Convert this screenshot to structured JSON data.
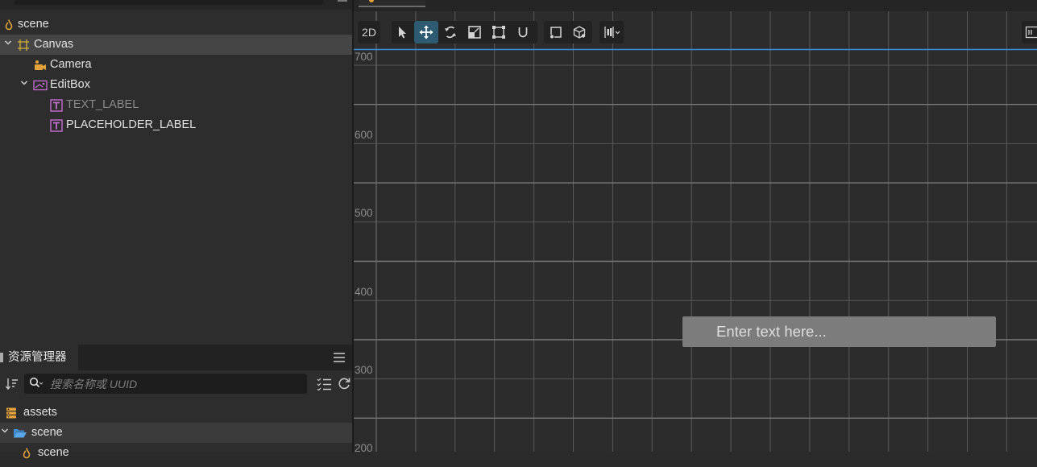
{
  "hierarchy": {
    "nodes": [
      {
        "label": "scene",
        "icon": "scene-icon",
        "expanded": null,
        "selected": false,
        "dim": false
      },
      {
        "label": "Canvas",
        "icon": "canvas-icon",
        "expanded": true,
        "selected": true,
        "dim": false
      },
      {
        "label": "Camera",
        "icon": "camera-icon",
        "expanded": null,
        "selected": false,
        "dim": false
      },
      {
        "label": "EditBox",
        "icon": "editbox-icon",
        "expanded": true,
        "selected": false,
        "dim": false
      },
      {
        "label": "TEXT_LABEL",
        "icon": "text-label-icon",
        "expanded": null,
        "selected": false,
        "dim": true
      },
      {
        "label": "PLACEHOLDER_LABEL",
        "icon": "text-label-icon",
        "expanded": null,
        "selected": false,
        "dim": false
      }
    ]
  },
  "assets": {
    "tab_label": "资源管理器",
    "search_placeholder": "搜索名称或 UUID",
    "items": [
      {
        "label": "assets",
        "icon": "assets-db-icon",
        "expanded": null,
        "selected": false
      },
      {
        "label": "scene",
        "icon": "folder-open-icon",
        "expanded": true,
        "selected": true
      },
      {
        "label": "scene",
        "icon": "scene-icon",
        "expanded": null,
        "selected": false
      }
    ]
  },
  "scene_view": {
    "mode_label": "2D",
    "tools": [
      "select-tool-icon",
      "move-tool-icon",
      "rotate-tool-icon",
      "scale-tool-icon",
      "rect-tool-icon",
      "snap-magnet-icon",
      "pivot-icon",
      "global-local-icon",
      "align-dropdown-icon"
    ],
    "active_tool": "move-tool-icon",
    "y_axis_labels": [
      "700",
      "600",
      "500",
      "400",
      "300",
      "200"
    ],
    "editbox_placeholder": "Enter text here..."
  },
  "colors": {
    "accent_blue": "#3d8ed6",
    "active_tool_bg": "#2e5a72",
    "scene_icon": "#e3a23a",
    "canvas_icon": "#d3b13a",
    "label_icon": "#c56fd0"
  }
}
